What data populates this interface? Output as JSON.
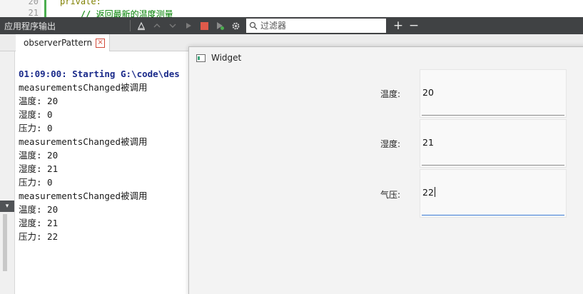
{
  "editor": {
    "line_numbers": [
      "20",
      "21"
    ],
    "code_line_1": "private:",
    "code_line_2": "    // 返回最新的温度测量"
  },
  "toolbar": {
    "title": "应用程序输出",
    "filter_placeholder": "过滤器",
    "add_symbol": "+",
    "remove_symbol": "−"
  },
  "tab": {
    "label": "observerPattern",
    "close_symbol": "×"
  },
  "output": {
    "lines": [
      "01:09:00: Starting G:\\code\\des",
      "measurementsChanged被调用",
      "温度: 20",
      "湿度: 0",
      "压力: 0",
      "measurementsChanged被调用",
      "温度: 20",
      "湿度: 21",
      "压力: 0",
      "measurementsChanged被调用",
      "温度: 20",
      "湿度: 21",
      "压力: 22"
    ]
  },
  "widget": {
    "title": "Widget",
    "fields": [
      {
        "label": "温度:",
        "value": "20"
      },
      {
        "label": "湿度:",
        "value": "21"
      },
      {
        "label": "气压:",
        "value": "22"
      }
    ]
  },
  "colors": {
    "toolbar_bg": "#404244",
    "start_line": "#1a2a8a",
    "keyword": "#808000",
    "comment": "#008000",
    "active_underline": "#3a7bd5"
  }
}
